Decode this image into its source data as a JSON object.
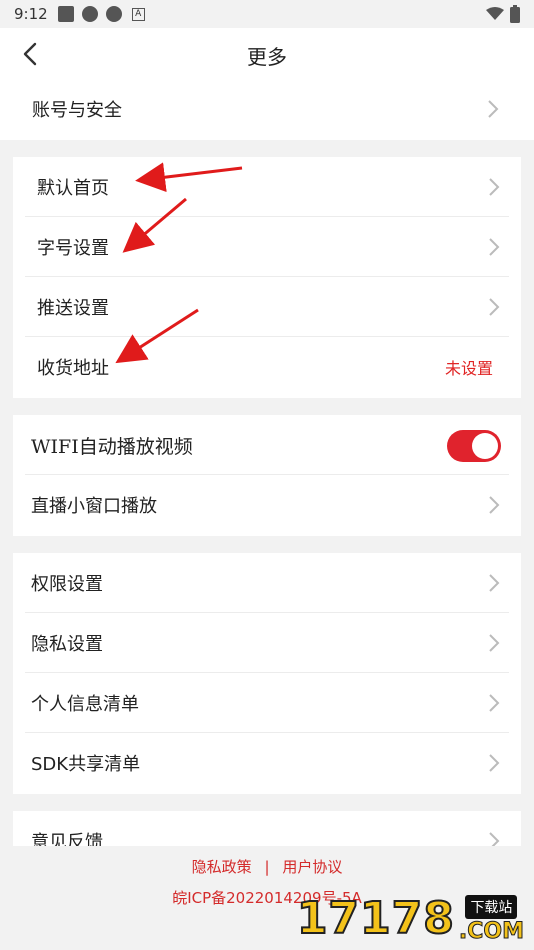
{
  "status_bar": {
    "time": "9:12"
  },
  "header": {
    "title": "更多"
  },
  "section_account": {
    "label": "账号与安全"
  },
  "section_general": {
    "items": [
      {
        "label": "默认首页"
      },
      {
        "label": "字号设置"
      },
      {
        "label": "推送设置"
      },
      {
        "label": "收货地址",
        "value": "未设置"
      }
    ]
  },
  "section_video": {
    "wifi_autoplay": {
      "label": "WIFI自动播放视频",
      "enabled": true
    },
    "pip": {
      "label": "直播小窗口播放"
    }
  },
  "section_privacy": {
    "items": [
      {
        "label": "权限设置"
      },
      {
        "label": "隐私设置"
      },
      {
        "label": "个人信息清单"
      },
      {
        "label": "SDK共享清单"
      }
    ]
  },
  "section_feedback": {
    "label": "意见反馈"
  },
  "footer": {
    "privacy_policy": "隐私政策",
    "separator": "|",
    "user_agreement": "用户协议",
    "icp": "皖ICP备2022014209号-5A"
  },
  "watermark": {
    "number": "17178",
    "download": "下载站",
    "com": ".COM"
  },
  "colors": {
    "accent": "#e0232d",
    "background": "#f2f2f2",
    "card": "#ffffff"
  }
}
